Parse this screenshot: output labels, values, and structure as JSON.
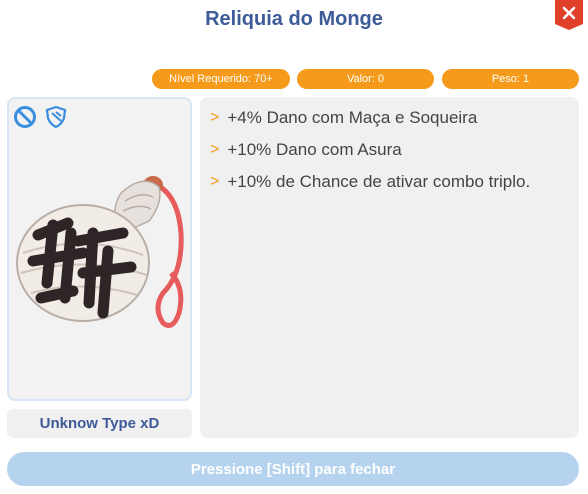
{
  "window": {
    "title": "Reliquia do Monge"
  },
  "stats": {
    "level": "Nível Requerido: 70+",
    "value": "Valor: 0",
    "weight": "Peso: 1"
  },
  "item": {
    "type": "Unknow Type xD",
    "icons": [
      "no-equip-icon",
      "shield-icon"
    ]
  },
  "description": [
    {
      "bullet": ">",
      "text": "+4% Dano com Maça e Soqueira"
    },
    {
      "bullet": ">",
      "text": "+10% Dano com Asura"
    },
    {
      "bullet": ">",
      "text": "+10% de Chance de ativar combo triplo."
    }
  ],
  "footer": {
    "close_hint": "Pressione [Shift] para fechar"
  },
  "colors": {
    "title": "#3d5a99",
    "accent": "#f59a1b",
    "close": "#e0402a",
    "footer": "#b5d3ee"
  }
}
